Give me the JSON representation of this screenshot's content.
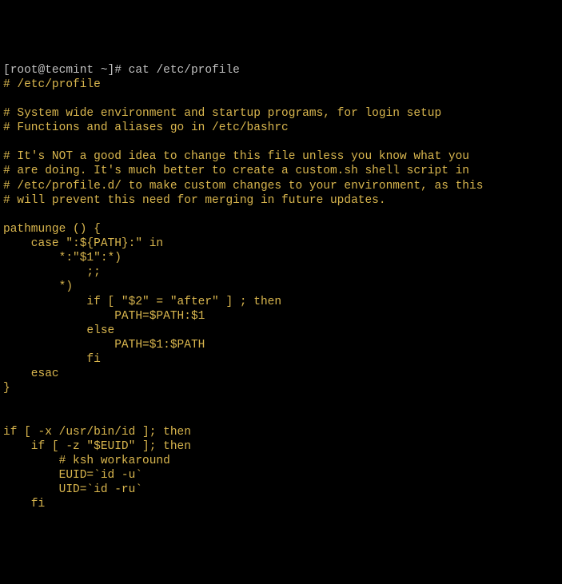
{
  "terminal": {
    "prompt": {
      "open_bracket": "[",
      "userhost": "root@tecmint",
      "path": " ~",
      "close_bracket": "]#",
      "command": " cat /etc/profile"
    },
    "lines": {
      "l01": "# /etc/profile",
      "l02": "",
      "l03": "# System wide environment and startup programs, for login setup",
      "l04": "# Functions and aliases go in /etc/bashrc",
      "l05": "",
      "l06": "# It's NOT a good idea to change this file unless you know what you",
      "l07": "# are doing. It's much better to create a custom.sh shell script in",
      "l08": "# /etc/profile.d/ to make custom changes to your environment, as this",
      "l09": "# will prevent this need for merging in future updates.",
      "l10": "",
      "l11": "pathmunge () {",
      "l12": "    case \":${PATH}:\" in",
      "l13": "        *:\"$1\":*)",
      "l14": "            ;;",
      "l15": "        *)",
      "l16": "            if [ \"$2\" = \"after\" ] ; then",
      "l17": "                PATH=$PATH:$1",
      "l18": "            else",
      "l19": "                PATH=$1:$PATH",
      "l20": "            fi",
      "l21": "    esac",
      "l22": "}",
      "l23": "",
      "l24": "",
      "l25": "if [ -x /usr/bin/id ]; then",
      "l26": "    if [ -z \"$EUID\" ]; then",
      "l27": "        # ksh workaround",
      "l28": "        EUID=`id -u`",
      "l29": "        UID=`id -ru`",
      "l30": "    fi"
    }
  }
}
